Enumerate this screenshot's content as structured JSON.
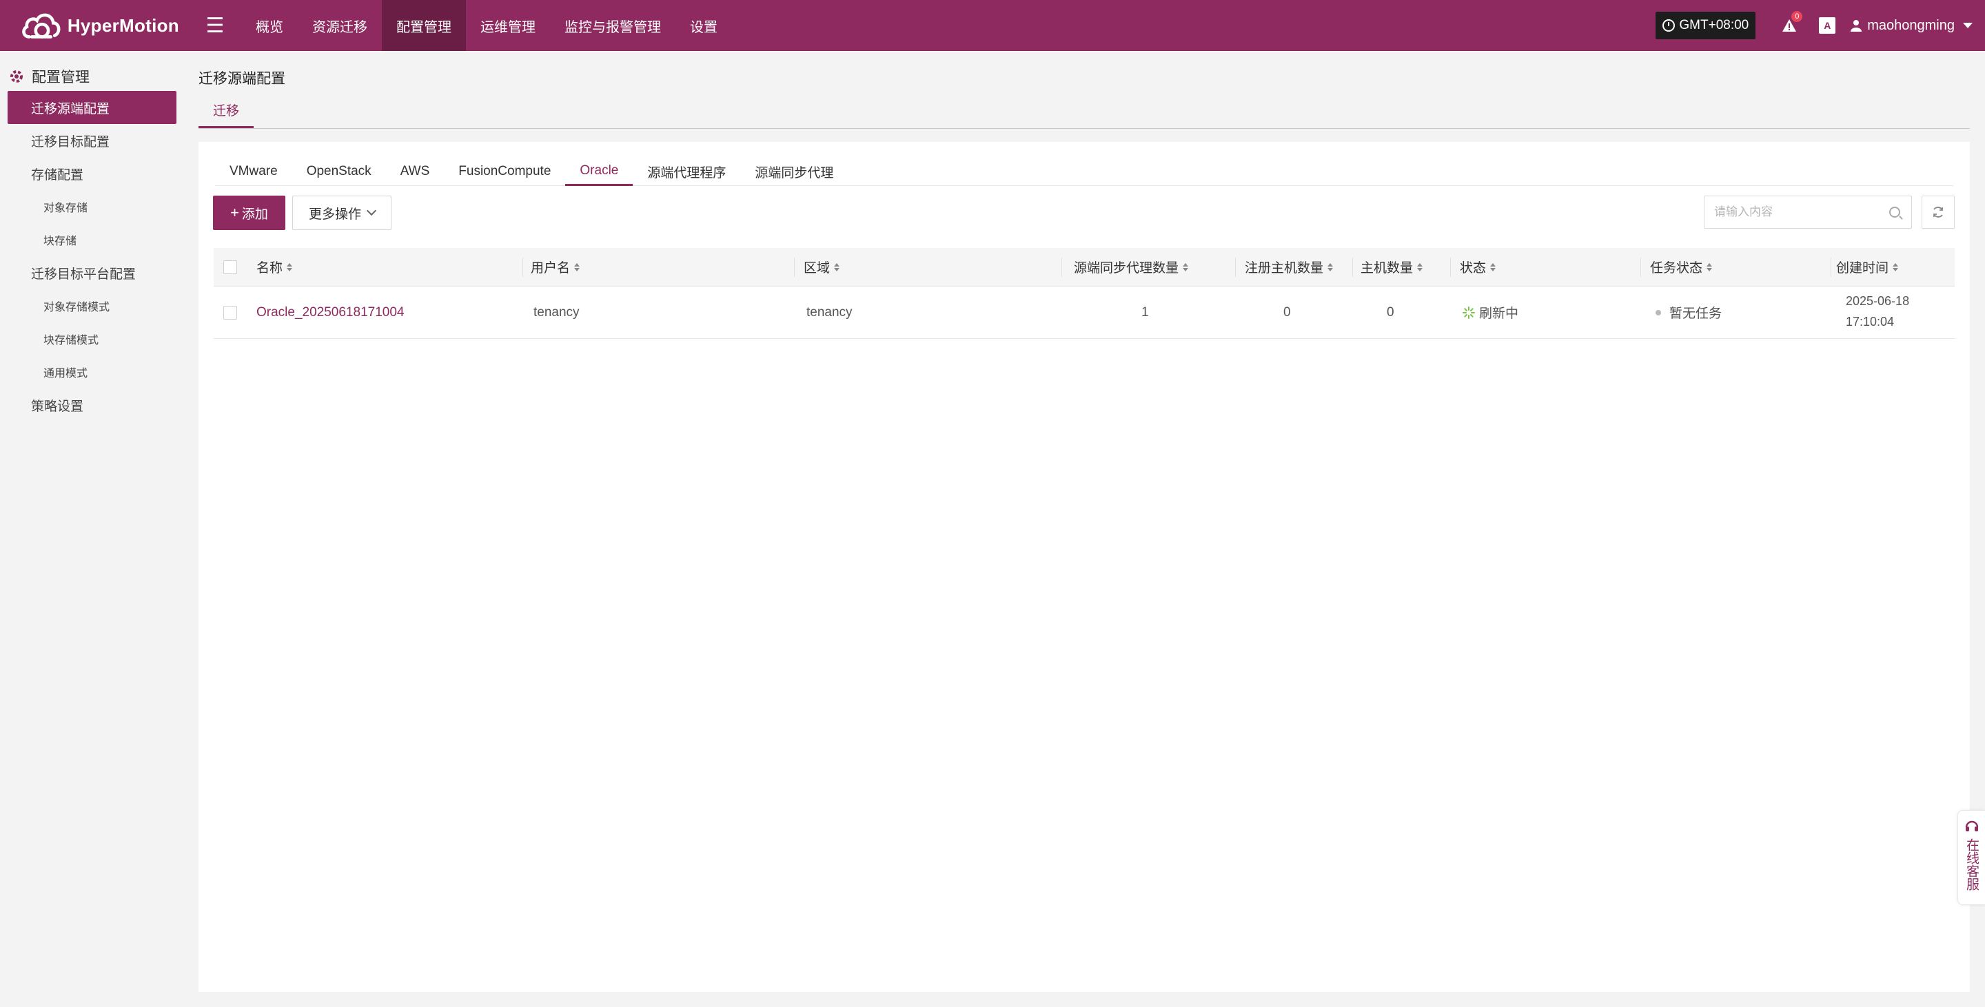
{
  "app": {
    "brand": "HyperMotion",
    "nav": [
      "概览",
      "资源迁移",
      "配置管理",
      "运维管理",
      "监控与报警管理",
      "设置"
    ],
    "timezone": "GMT+08:00",
    "alert_count": "0",
    "lang_icon": "A",
    "username": "maohongming",
    "accent_color": "#8e2a5f"
  },
  "sidebar": {
    "title": "配置管理",
    "items": [
      {
        "label": "迁移源端配置"
      },
      {
        "label": "迁移目标配置"
      },
      {
        "label": "存储配置"
      },
      {
        "label": "对象存储"
      },
      {
        "label": "块存储"
      },
      {
        "label": "迁移目标平台配置"
      },
      {
        "label": "对象存储模式"
      },
      {
        "label": "块存储模式"
      },
      {
        "label": "通用模式"
      },
      {
        "label": "策略设置"
      }
    ]
  },
  "main": {
    "title": "迁移源端配置",
    "top_tab": "迁移",
    "subtabs": [
      "VMware",
      "OpenStack",
      "AWS",
      "FusionCompute",
      "Oracle",
      "源端代理程序",
      "源端同步代理"
    ],
    "add_button": "添加",
    "more_button": "更多操作",
    "search_placeholder": "请输入内容",
    "table": {
      "columns": [
        "名称",
        "用户名",
        "区域",
        "源端同步代理数量",
        "注册主机数量",
        "主机数量",
        "状态",
        "任务状态",
        "创建时间"
      ],
      "rows": [
        {
          "name": "Oracle_20250618171004",
          "username": "tenancy",
          "region": "tenancy",
          "sync_agents": "1",
          "registered_hosts": "0",
          "hosts": "0",
          "status": "刷新中",
          "task_status": "暂无任务",
          "created_date": "2025-06-18",
          "created_time": "17:10:04"
        }
      ]
    }
  },
  "helper": {
    "label": "在线客服"
  }
}
